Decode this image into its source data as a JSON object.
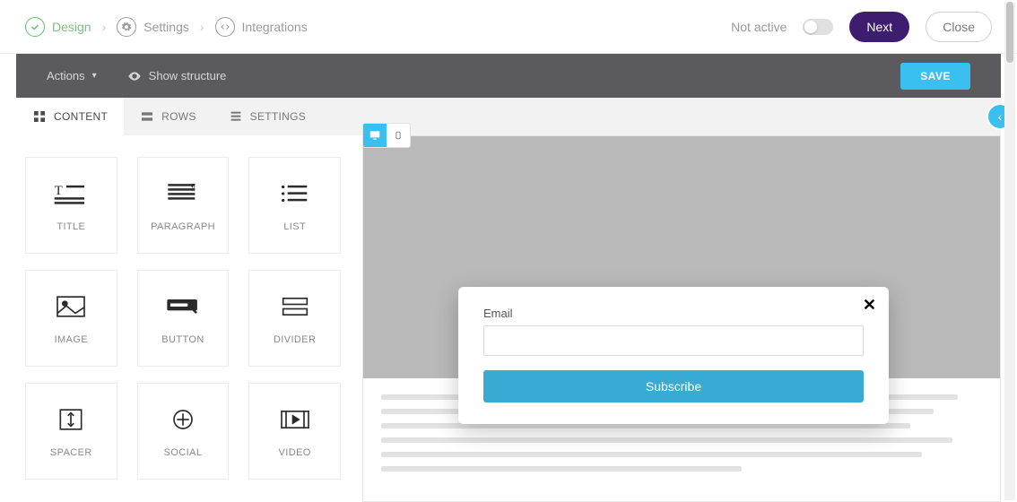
{
  "breadcrumb": {
    "design": "Design",
    "settings": "Settings",
    "integrations": "Integrations"
  },
  "top": {
    "not_active": "Not active",
    "next": "Next",
    "close": "Close"
  },
  "actionbar": {
    "actions": "Actions",
    "show_structure": "Show structure",
    "save": "SAVE"
  },
  "tabs": {
    "content": "CONTENT",
    "rows": "ROWS",
    "settings": "SETTINGS"
  },
  "blocks": {
    "title": "TITLE",
    "paragraph": "PARAGRAPH",
    "list": "LIST",
    "image": "IMAGE",
    "button": "BUTTON",
    "divider": "DIVIDER",
    "spacer": "SPACER",
    "social": "SOCIAL",
    "video": "VIDEO"
  },
  "form": {
    "email_label": "Email",
    "email_value": "",
    "subscribe": "Subscribe"
  },
  "colors": {
    "accent_blue": "#39bff0",
    "next_purple": "#3e1c70",
    "success_green": "#5fc06e"
  }
}
